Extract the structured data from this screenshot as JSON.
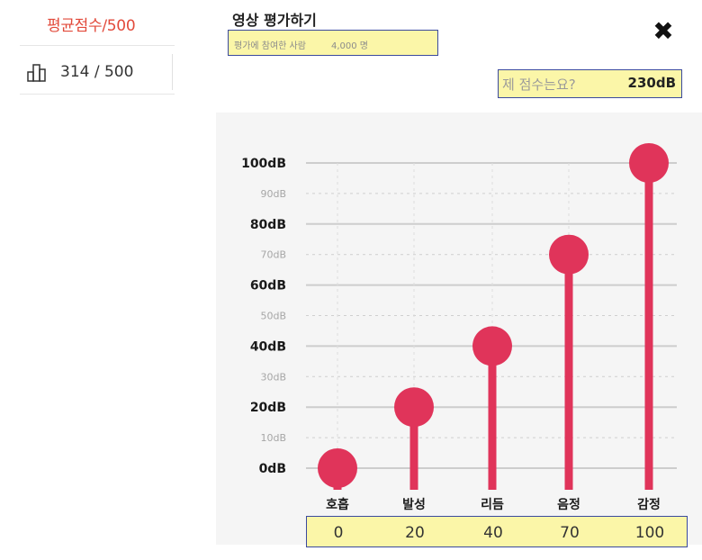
{
  "sidebar": {
    "avg_title": "평균점수/500",
    "avg_value": "314 / 500",
    "icon": "bar-chart-icon"
  },
  "header": {
    "title": "영상 평가하기",
    "participants_label": "평가에 참여한 사람",
    "participants_count": "4,000 명",
    "close_icon": "close-icon",
    "score_label": "제 점수는요?",
    "score_value": "230dB"
  },
  "colors": {
    "accent": "#e0345a",
    "highlight": "#fbf6a8",
    "title_red": "#e24a3b"
  },
  "chart_data": {
    "type": "bar",
    "categories": [
      "호흡",
      "발성",
      "리듬",
      "음정",
      "감정"
    ],
    "values": [
      0,
      20,
      40,
      70,
      100
    ],
    "value_labels": [
      "0",
      "20",
      "40",
      "70",
      "100"
    ],
    "ylim": [
      0,
      100
    ],
    "major_ticks": [
      "0dB",
      "20dB",
      "40dB",
      "60dB",
      "80dB",
      "100dB"
    ],
    "minor_ticks": [
      "10dB",
      "30dB",
      "50dB",
      "70dB",
      "90dB"
    ],
    "grid": true
  }
}
